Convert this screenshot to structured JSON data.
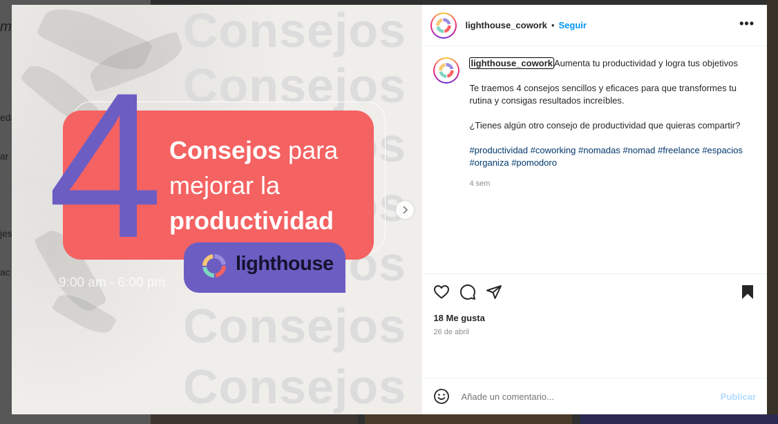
{
  "background": {
    "sidebar_fragments": [
      "m",
      "eda",
      "ar",
      "jes",
      "ac"
    ]
  },
  "post_image": {
    "watermark_word": "Consejos",
    "big_number": "4",
    "headline_bold_1": "Consejos",
    "headline_rest_1": " para",
    "headline_line_2": "mejorar la",
    "headline_bold_3": "productividad",
    "logo_text": "lighthouse",
    "hours": "9:00 am - 6:00 pm",
    "accent_purple": "#6c5dc3",
    "accent_red": "#f56262"
  },
  "header": {
    "username": "lighthouse_cowork",
    "separator": "•",
    "follow_label": "Seguir",
    "more_label": "•••"
  },
  "caption": {
    "username": "lighthouse_cowork",
    "line1": "Aumenta tu productividad y logra tus objetivos",
    "para2": "Te traemos 4 consejos sencillos y eficaces para que transformes tu rutina y consigas resultados increíbles.",
    "para3": "¿Tienes algún otro consejo de productividad que quieras compartir?",
    "hashtags": [
      "#productividad",
      "#coworking",
      "#nomadas",
      "#nomad",
      "#freelance",
      "#espacios",
      "#organiza",
      "#pomodoro"
    ],
    "time_ago": "4 sem"
  },
  "actions": {
    "likes": "18 Me gusta",
    "date": "26 de abril"
  },
  "comment": {
    "placeholder": "Añade un comentario...",
    "publish_label": "Publicar"
  },
  "colors": {
    "link_blue": "#0095f6",
    "hashtag_blue": "#00376b",
    "publish_disabled": "#b3dbff"
  }
}
